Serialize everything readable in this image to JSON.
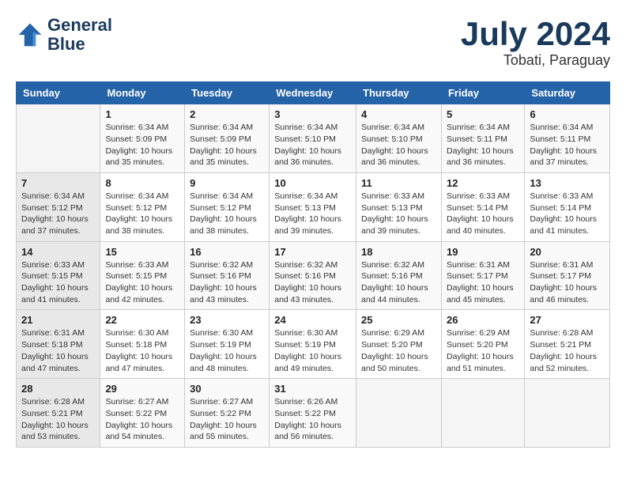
{
  "header": {
    "logo_line1": "General",
    "logo_line2": "Blue",
    "title": "July 2024",
    "subtitle": "Tobati, Paraguay"
  },
  "calendar": {
    "headers": [
      "Sunday",
      "Monday",
      "Tuesday",
      "Wednesday",
      "Thursday",
      "Friday",
      "Saturday"
    ],
    "weeks": [
      [
        {
          "day": "",
          "sunrise": "",
          "sunset": "",
          "daylight": ""
        },
        {
          "day": "1",
          "sunrise": "Sunrise: 6:34 AM",
          "sunset": "Sunset: 5:09 PM",
          "daylight": "Daylight: 10 hours and 35 minutes."
        },
        {
          "day": "2",
          "sunrise": "Sunrise: 6:34 AM",
          "sunset": "Sunset: 5:09 PM",
          "daylight": "Daylight: 10 hours and 35 minutes."
        },
        {
          "day": "3",
          "sunrise": "Sunrise: 6:34 AM",
          "sunset": "Sunset: 5:10 PM",
          "daylight": "Daylight: 10 hours and 36 minutes."
        },
        {
          "day": "4",
          "sunrise": "Sunrise: 6:34 AM",
          "sunset": "Sunset: 5:10 PM",
          "daylight": "Daylight: 10 hours and 36 minutes."
        },
        {
          "day": "5",
          "sunrise": "Sunrise: 6:34 AM",
          "sunset": "Sunset: 5:11 PM",
          "daylight": "Daylight: 10 hours and 36 minutes."
        },
        {
          "day": "6",
          "sunrise": "Sunrise: 6:34 AM",
          "sunset": "Sunset: 5:11 PM",
          "daylight": "Daylight: 10 hours and 37 minutes."
        }
      ],
      [
        {
          "day": "7",
          "sunrise": "Sunrise: 6:34 AM",
          "sunset": "Sunset: 5:12 PM",
          "daylight": "Daylight: 10 hours and 37 minutes."
        },
        {
          "day": "8",
          "sunrise": "Sunrise: 6:34 AM",
          "sunset": "Sunset: 5:12 PM",
          "daylight": "Daylight: 10 hours and 38 minutes."
        },
        {
          "day": "9",
          "sunrise": "Sunrise: 6:34 AM",
          "sunset": "Sunset: 5:12 PM",
          "daylight": "Daylight: 10 hours and 38 minutes."
        },
        {
          "day": "10",
          "sunrise": "Sunrise: 6:34 AM",
          "sunset": "Sunset: 5:13 PM",
          "daylight": "Daylight: 10 hours and 39 minutes."
        },
        {
          "day": "11",
          "sunrise": "Sunrise: 6:33 AM",
          "sunset": "Sunset: 5:13 PM",
          "daylight": "Daylight: 10 hours and 39 minutes."
        },
        {
          "day": "12",
          "sunrise": "Sunrise: 6:33 AM",
          "sunset": "Sunset: 5:14 PM",
          "daylight": "Daylight: 10 hours and 40 minutes."
        },
        {
          "day": "13",
          "sunrise": "Sunrise: 6:33 AM",
          "sunset": "Sunset: 5:14 PM",
          "daylight": "Daylight: 10 hours and 41 minutes."
        }
      ],
      [
        {
          "day": "14",
          "sunrise": "Sunrise: 6:33 AM",
          "sunset": "Sunset: 5:15 PM",
          "daylight": "Daylight: 10 hours and 41 minutes."
        },
        {
          "day": "15",
          "sunrise": "Sunrise: 6:33 AM",
          "sunset": "Sunset: 5:15 PM",
          "daylight": "Daylight: 10 hours and 42 minutes."
        },
        {
          "day": "16",
          "sunrise": "Sunrise: 6:32 AM",
          "sunset": "Sunset: 5:16 PM",
          "daylight": "Daylight: 10 hours and 43 minutes."
        },
        {
          "day": "17",
          "sunrise": "Sunrise: 6:32 AM",
          "sunset": "Sunset: 5:16 PM",
          "daylight": "Daylight: 10 hours and 43 minutes."
        },
        {
          "day": "18",
          "sunrise": "Sunrise: 6:32 AM",
          "sunset": "Sunset: 5:16 PM",
          "daylight": "Daylight: 10 hours and 44 minutes."
        },
        {
          "day": "19",
          "sunrise": "Sunrise: 6:31 AM",
          "sunset": "Sunset: 5:17 PM",
          "daylight": "Daylight: 10 hours and 45 minutes."
        },
        {
          "day": "20",
          "sunrise": "Sunrise: 6:31 AM",
          "sunset": "Sunset: 5:17 PM",
          "daylight": "Daylight: 10 hours and 46 minutes."
        }
      ],
      [
        {
          "day": "21",
          "sunrise": "Sunrise: 6:31 AM",
          "sunset": "Sunset: 5:18 PM",
          "daylight": "Daylight: 10 hours and 47 minutes."
        },
        {
          "day": "22",
          "sunrise": "Sunrise: 6:30 AM",
          "sunset": "Sunset: 5:18 PM",
          "daylight": "Daylight: 10 hours and 47 minutes."
        },
        {
          "day": "23",
          "sunrise": "Sunrise: 6:30 AM",
          "sunset": "Sunset: 5:19 PM",
          "daylight": "Daylight: 10 hours and 48 minutes."
        },
        {
          "day": "24",
          "sunrise": "Sunrise: 6:30 AM",
          "sunset": "Sunset: 5:19 PM",
          "daylight": "Daylight: 10 hours and 49 minutes."
        },
        {
          "day": "25",
          "sunrise": "Sunrise: 6:29 AM",
          "sunset": "Sunset: 5:20 PM",
          "daylight": "Daylight: 10 hours and 50 minutes."
        },
        {
          "day": "26",
          "sunrise": "Sunrise: 6:29 AM",
          "sunset": "Sunset: 5:20 PM",
          "daylight": "Daylight: 10 hours and 51 minutes."
        },
        {
          "day": "27",
          "sunrise": "Sunrise: 6:28 AM",
          "sunset": "Sunset: 5:21 PM",
          "daylight": "Daylight: 10 hours and 52 minutes."
        }
      ],
      [
        {
          "day": "28",
          "sunrise": "Sunrise: 6:28 AM",
          "sunset": "Sunset: 5:21 PM",
          "daylight": "Daylight: 10 hours and 53 minutes."
        },
        {
          "day": "29",
          "sunrise": "Sunrise: 6:27 AM",
          "sunset": "Sunset: 5:22 PM",
          "daylight": "Daylight: 10 hours and 54 minutes."
        },
        {
          "day": "30",
          "sunrise": "Sunrise: 6:27 AM",
          "sunset": "Sunset: 5:22 PM",
          "daylight": "Daylight: 10 hours and 55 minutes."
        },
        {
          "day": "31",
          "sunrise": "Sunrise: 6:26 AM",
          "sunset": "Sunset: 5:22 PM",
          "daylight": "Daylight: 10 hours and 56 minutes."
        },
        {
          "day": "",
          "sunrise": "",
          "sunset": "",
          "daylight": ""
        },
        {
          "day": "",
          "sunrise": "",
          "sunset": "",
          "daylight": ""
        },
        {
          "day": "",
          "sunrise": "",
          "sunset": "",
          "daylight": ""
        }
      ]
    ]
  }
}
